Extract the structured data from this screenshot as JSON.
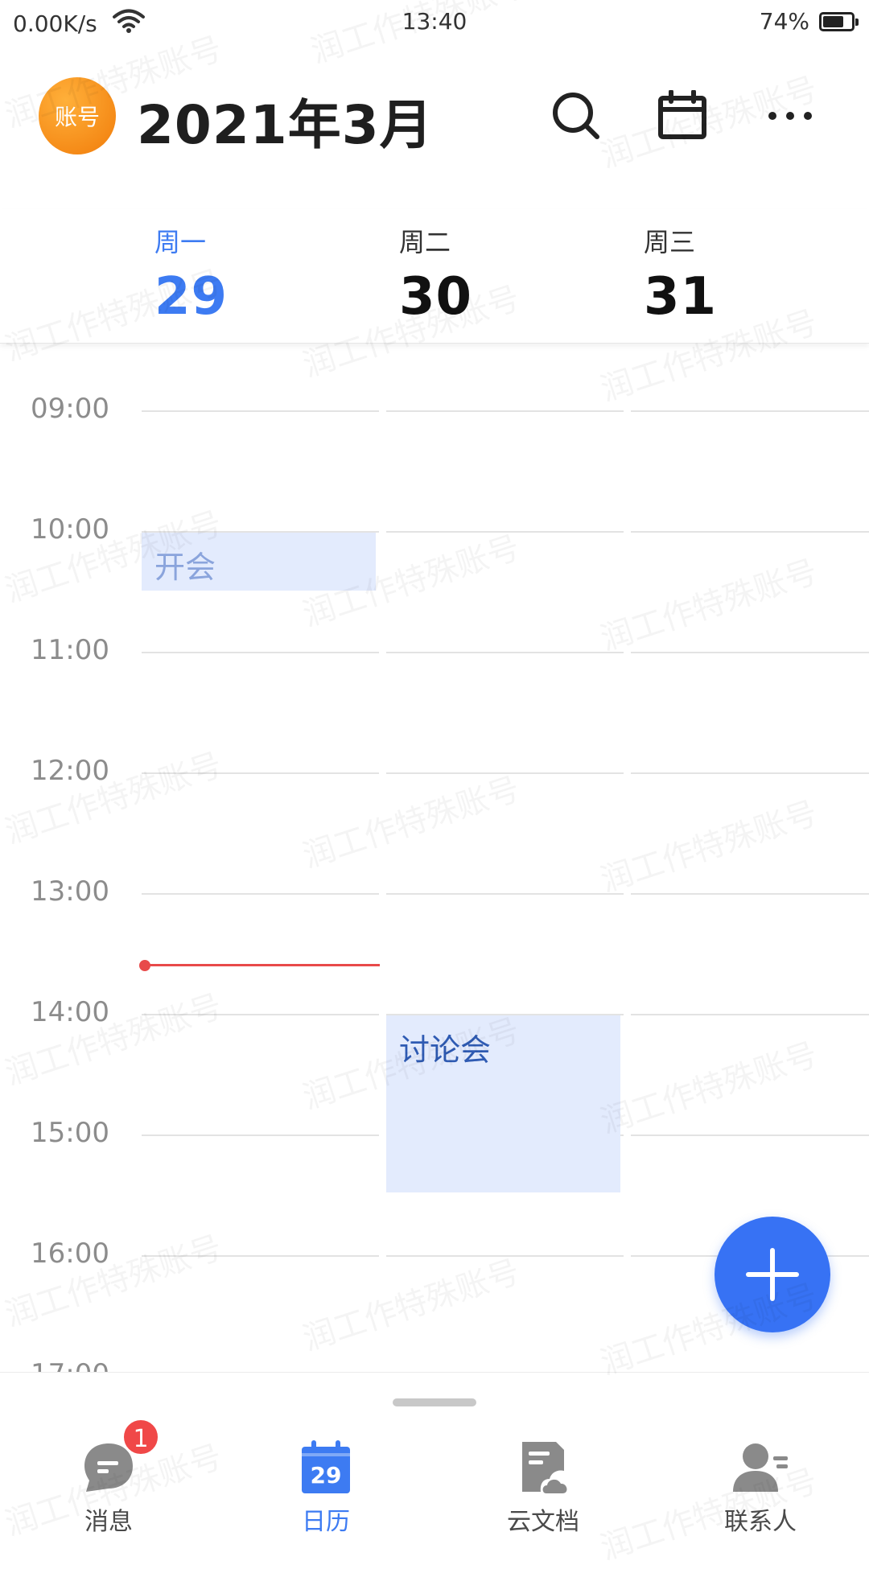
{
  "status_bar": {
    "network_speed": "0.00K/s",
    "time": "13:40",
    "battery_percent": "74%",
    "battery_level": 0.74
  },
  "header": {
    "avatar_text": "账号",
    "title": "2021年3月",
    "icons": [
      "search-icon",
      "calendar-icon",
      "more-icon"
    ]
  },
  "week": {
    "days": [
      {
        "name": "周一",
        "date": "29",
        "today": true
      },
      {
        "name": "周二",
        "date": "30",
        "today": false
      },
      {
        "name": "周三",
        "date": "31",
        "today": false
      }
    ]
  },
  "timeline": {
    "hours": [
      "09:00",
      "10:00",
      "11:00",
      "12:00",
      "13:00",
      "14:00",
      "15:00",
      "16:00",
      "17:00"
    ],
    "current_time": "13:40",
    "events": [
      {
        "title": "开会",
        "day": "周一",
        "start": "10:00",
        "end": "10:30"
      },
      {
        "title": "讨论会",
        "day": "周二",
        "start": "14:00",
        "end": "15:30"
      }
    ]
  },
  "colors": {
    "accent": "#3d7bf2",
    "fab": "#3772f4",
    "event_bg": "#e3ebfd",
    "now_line": "#e84a4a",
    "badge": "#f04848",
    "avatar": "#f17c0a"
  },
  "bottom_nav": {
    "items": [
      {
        "label": "消息",
        "icon": "message-icon",
        "badge": "1",
        "active": false
      },
      {
        "label": "日历",
        "icon": "calendar-tab-icon",
        "icon_text": "29",
        "active": true
      },
      {
        "label": "云文档",
        "icon": "cloud-doc-icon",
        "active": false
      },
      {
        "label": "联系人",
        "icon": "contacts-icon",
        "active": false
      }
    ]
  },
  "watermark_text": "润工作特殊账号"
}
